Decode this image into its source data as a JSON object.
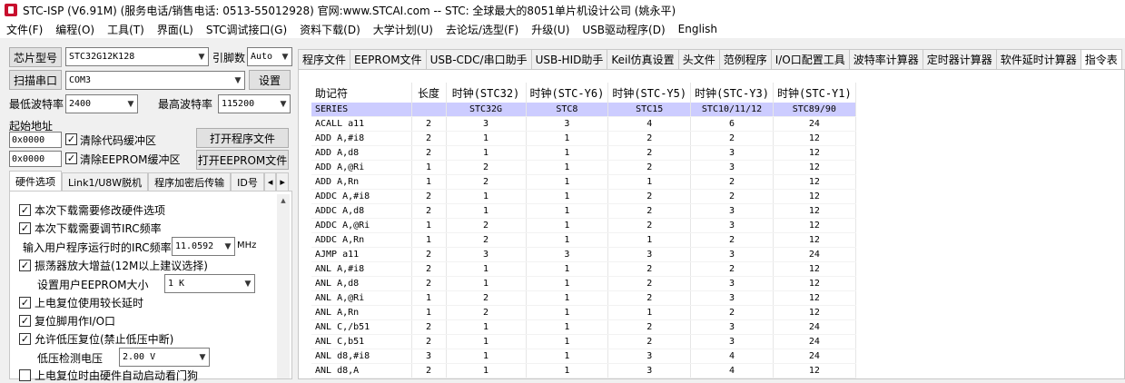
{
  "window": {
    "title": "STC-ISP (V6.91M) (服务电话/销售电话: 0513-55012928) 官网:www.STCAI.com  -- STC: 全球最大的8051单片机设计公司 (姚永平)"
  },
  "menu": [
    "文件(F)",
    "编程(O)",
    "工具(T)",
    "界面(L)",
    "STC调试接口(G)",
    "资料下载(D)",
    "大学计划(U)",
    "去论坛/选型(F)",
    "升级(U)",
    "USB驱动程序(D)",
    "English"
  ],
  "left": {
    "chip_btn": "芯片型号",
    "chip_value": "STC32G12K128",
    "pin_label": "引脚数",
    "pin_value": "Auto",
    "scan_btn": "扫描串口",
    "com_value": "COM3",
    "settings_btn": "设置",
    "min_baud_label": "最低波特率",
    "min_baud_value": "2400",
    "max_baud_label": "最高波特率",
    "max_baud_value": "115200",
    "start_addr_label": "起始地址",
    "addr1": "0x0000",
    "clear_code": "清除代码缓冲区",
    "open_prog": "打开程序文件",
    "addr2": "0x0000",
    "clear_eeprom": "清除EEPROM缓冲区",
    "open_eeprom": "打开EEPROM文件",
    "subtabs": [
      "硬件选项",
      "Link1/U8W脱机",
      "程序加密后传输",
      "ID号"
    ],
    "hw": {
      "opt1": "本次下载需要修改硬件选项",
      "opt2": "本次下载需要调节IRC频率",
      "irc_label": "输入用户程序运行时的IRC频率",
      "irc_value": "11.0592",
      "irc_unit": "MHz",
      "opt3": "振荡器放大增益(12M以上建议选择)",
      "eeprom_label": "设置用户EEPROM大小",
      "eeprom_value": "1   K",
      "opt4": "上电复位使用较长延时",
      "opt5": "复位脚用作I/O口",
      "opt6": "允许低压复位(禁止低压中断)",
      "lv_label": "低压检测电压",
      "lv_value": "2.00 V",
      "opt7": "上电复位时由硬件自动启动看门狗"
    }
  },
  "tabs": [
    "程序文件",
    "EEPROM文件",
    "USB-CDC/串口助手",
    "USB-HID助手",
    "Keil仿真设置",
    "头文件",
    "范例程序",
    "I/O口配置工具",
    "波特率计算器",
    "定时器计算器",
    "软件延时计算器",
    "指令表"
  ],
  "table": {
    "headers": [
      "助记符",
      "长度",
      "时钟(STC32)",
      "时钟(STC-Y6)",
      "时钟(STC-Y5)",
      "时钟(STC-Y3)",
      "时钟(STC-Y1)"
    ],
    "series": [
      "SERIES",
      "",
      "STC32G",
      "STC8",
      "STC15",
      "STC10/11/12",
      "STC89/90"
    ],
    "rows": [
      [
        "ACALL a11",
        "2",
        "3",
        "3",
        "4",
        "6",
        "24"
      ],
      [
        "ADD A,#i8",
        "2",
        "1",
        "1",
        "2",
        "2",
        "12"
      ],
      [
        "ADD A,d8",
        "2",
        "1",
        "1",
        "2",
        "3",
        "12"
      ],
      [
        "ADD A,@Ri",
        "1",
        "2",
        "1",
        "2",
        "3",
        "12"
      ],
      [
        "ADD A,Rn",
        "1",
        "2",
        "1",
        "1",
        "2",
        "12"
      ],
      [
        "ADDC A,#i8",
        "2",
        "1",
        "1",
        "2",
        "2",
        "12"
      ],
      [
        "ADDC A,d8",
        "2",
        "1",
        "1",
        "2",
        "3",
        "12"
      ],
      [
        "ADDC A,@Ri",
        "1",
        "2",
        "1",
        "2",
        "3",
        "12"
      ],
      [
        "ADDC A,Rn",
        "1",
        "2",
        "1",
        "1",
        "2",
        "12"
      ],
      [
        "AJMP a11",
        "2",
        "3",
        "3",
        "3",
        "3",
        "24"
      ],
      [
        "ANL A,#i8",
        "2",
        "1",
        "1",
        "2",
        "2",
        "12"
      ],
      [
        "ANL A,d8",
        "2",
        "1",
        "1",
        "2",
        "3",
        "12"
      ],
      [
        "ANL A,@Ri",
        "1",
        "2",
        "1",
        "2",
        "3",
        "12"
      ],
      [
        "ANL A,Rn",
        "1",
        "2",
        "1",
        "1",
        "2",
        "12"
      ],
      [
        "ANL C,/b51",
        "2",
        "1",
        "1",
        "2",
        "3",
        "24"
      ],
      [
        "ANL C,b51",
        "2",
        "1",
        "1",
        "2",
        "3",
        "24"
      ],
      [
        "ANL d8,#i8",
        "3",
        "1",
        "1",
        "3",
        "4",
        "24"
      ],
      [
        "ANL d8,A",
        "2",
        "1",
        "1",
        "3",
        "4",
        "12"
      ]
    ]
  }
}
